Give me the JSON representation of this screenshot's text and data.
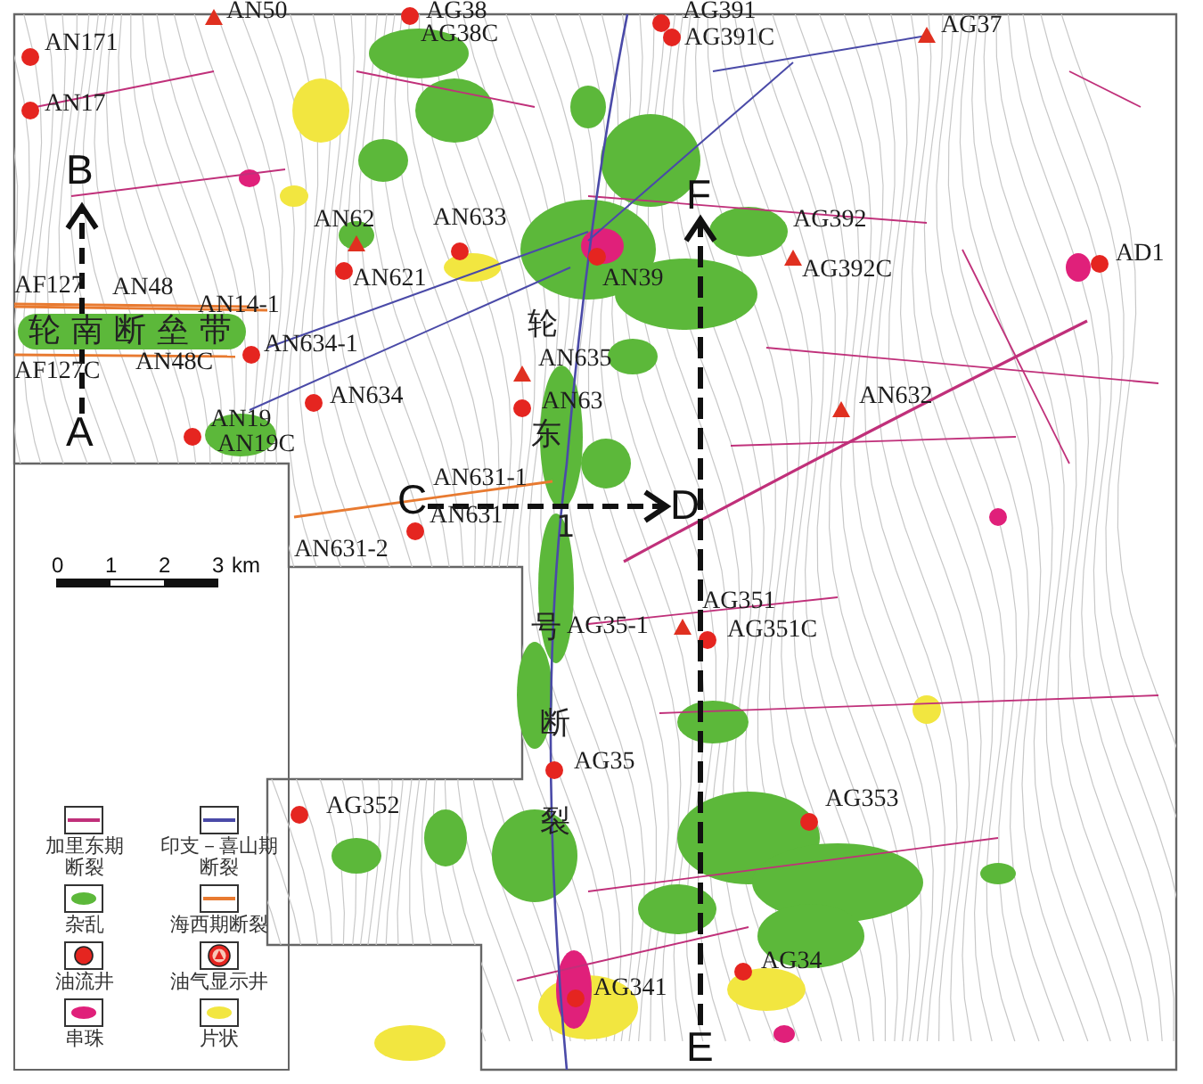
{
  "wells": [
    {
      "name": "AN50",
      "kind": "show"
    },
    {
      "name": "AG38",
      "kind": "oil"
    },
    {
      "name": "AG38C",
      "kind": "none"
    },
    {
      "name": "AG391",
      "kind": "oil"
    },
    {
      "name": "AG391C",
      "kind": "oil"
    },
    {
      "name": "AG37",
      "kind": "show"
    },
    {
      "name": "AN171",
      "kind": "oil"
    },
    {
      "name": "AN17",
      "kind": "oil"
    },
    {
      "name": "AN62",
      "kind": "show"
    },
    {
      "name": "AN633",
      "kind": "oil"
    },
    {
      "name": "AN621",
      "kind": "oil"
    },
    {
      "name": "AN39",
      "kind": "oil"
    },
    {
      "name": "AG392",
      "kind": "none"
    },
    {
      "name": "AG392C",
      "kind": "show"
    },
    {
      "name": "AD1",
      "kind": "oil"
    },
    {
      "name": "AF127",
      "kind": "none"
    },
    {
      "name": "AN48",
      "kind": "none"
    },
    {
      "name": "AN14-1",
      "kind": "none"
    },
    {
      "name": "AF127C",
      "kind": "none"
    },
    {
      "name": "AN48C",
      "kind": "none"
    },
    {
      "name": "AN634-1",
      "kind": "oil"
    },
    {
      "name": "AN635",
      "kind": "show"
    },
    {
      "name": "AN634",
      "kind": "oil"
    },
    {
      "name": "AN63",
      "kind": "oil"
    },
    {
      "name": "AN19",
      "kind": "oil"
    },
    {
      "name": "AN19C",
      "kind": "none"
    },
    {
      "name": "AN632",
      "kind": "show"
    },
    {
      "name": "AN631-1",
      "kind": "none"
    },
    {
      "name": "AN631",
      "kind": "oil"
    },
    {
      "name": "AN631-2",
      "kind": "none"
    },
    {
      "name": "AG351",
      "kind": "none"
    },
    {
      "name": "AG35-1",
      "kind": "show"
    },
    {
      "name": "AG351C",
      "kind": "oil"
    },
    {
      "name": "AG35",
      "kind": "oil"
    },
    {
      "name": "AG352",
      "kind": "oil"
    },
    {
      "name": "AG353",
      "kind": "oil"
    },
    {
      "name": "AG341",
      "kind": "oil"
    },
    {
      "name": "AG34",
      "kind": "oil"
    }
  ],
  "zone_label": "轮南断垒带",
  "fault_label_parts": [
    "轮",
    "东",
    "1",
    "号",
    "断",
    "裂"
  ],
  "section_letters": [
    "B",
    "A",
    "C",
    "D",
    "F",
    "E"
  ],
  "scale_bar": {
    "ticks": [
      "0",
      "1",
      "2",
      "3"
    ],
    "unit": "km"
  },
  "legend": [
    {
      "kind": "line",
      "color": "#c0307a",
      "label": "加里东期断裂"
    },
    {
      "kind": "line",
      "color": "#4a4aa8",
      "label": "印支－喜山期断裂"
    },
    {
      "kind": "patch",
      "color": "#5cb83a",
      "label": "杂乱"
    },
    {
      "kind": "line",
      "color": "#e87a30",
      "label": "海西期断裂"
    },
    {
      "kind": "oil_well",
      "color": "#e52520",
      "label": "油流井"
    },
    {
      "kind": "show_well",
      "color": "#e52520",
      "label": "油气显示井"
    },
    {
      "kind": "patch",
      "color": "#e0207a",
      "label": "串珠"
    },
    {
      "kind": "patch",
      "color": "#f2e640",
      "label": "片状"
    }
  ]
}
